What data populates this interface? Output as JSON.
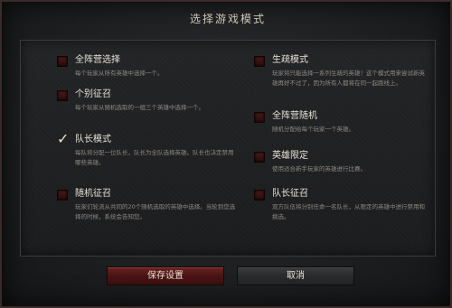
{
  "dialog": {
    "title": "选择游戏模式"
  },
  "options": [
    {
      "id": "all-pick",
      "label": "全阵营选择",
      "checked": false,
      "desc": "每个玩家从所有英雄中选择一个。"
    },
    {
      "id": "random-draft",
      "label": "个别征召",
      "checked": false,
      "desc": "每个玩家从随机选取的一组三个英雄中选择一个。"
    },
    {
      "id": "captains-mode",
      "label": "队长模式",
      "checked": true,
      "desc": "每队将分配一位队长，队长为全队选择英雄。队长也决定禁用哪些英雄。"
    },
    {
      "id": "random-draft-pool",
      "label": "随机征召",
      "checked": false,
      "desc": "玩家们轮流从共同的20个随机选取的英雄中选择。当轮到您选择的时候，系统会告知您。"
    },
    {
      "id": "single-draft",
      "label": "生疏模式",
      "checked": false,
      "desc": "玩家将只能选择一系列生疏的英雄！这个模式用来尝试新英雄再好不过了，因为所有人都将在同一起跑线上。"
    },
    {
      "id": "all-random",
      "label": "全阵营随机",
      "checked": false,
      "desc": "随机分配给每个玩家一个英雄。"
    },
    {
      "id": "limited-heroes",
      "label": "英雄限定",
      "checked": false,
      "desc": "使用适合新手玩家的英雄进行比赛。"
    },
    {
      "id": "captains-draft",
      "label": "队长征召",
      "checked": false,
      "desc": "双方队伍将分别任命一名队长，从限定的英雄中进行禁用和挑选。"
    }
  ],
  "buttons": {
    "save": "保存设置",
    "cancel": "取消"
  }
}
